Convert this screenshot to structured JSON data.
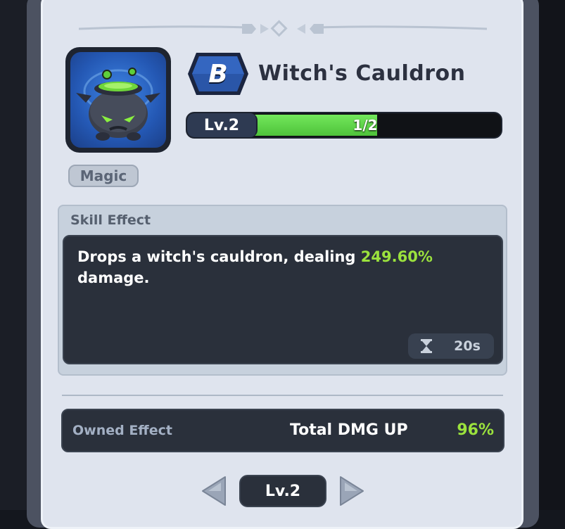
{
  "item": {
    "grade": "B",
    "name": "Witch's Cauldron",
    "icon": "witch-cauldron-icon",
    "level_label": "Lv.2",
    "progress_text": "1/2",
    "progress_fraction": 0.5,
    "type_tag": "Magic"
  },
  "skill": {
    "section_label": "Skill Effect",
    "description_prefix": "Drops a witch's cauldron, dealing ",
    "damage_value": "249.60%",
    "description_suffix": "damage.",
    "cooldown": "20s"
  },
  "owned": {
    "label": "Owned Effect",
    "stat": "Total DMG UP",
    "value": "96%"
  },
  "nav": {
    "level_label": "Lv.2"
  },
  "colors": {
    "panel": "#dfe4ee",
    "dark_box": "#2a303b",
    "highlight": "#9be23d",
    "progress_fill": "#5cd447",
    "badge_blue": "#2a56a8"
  }
}
